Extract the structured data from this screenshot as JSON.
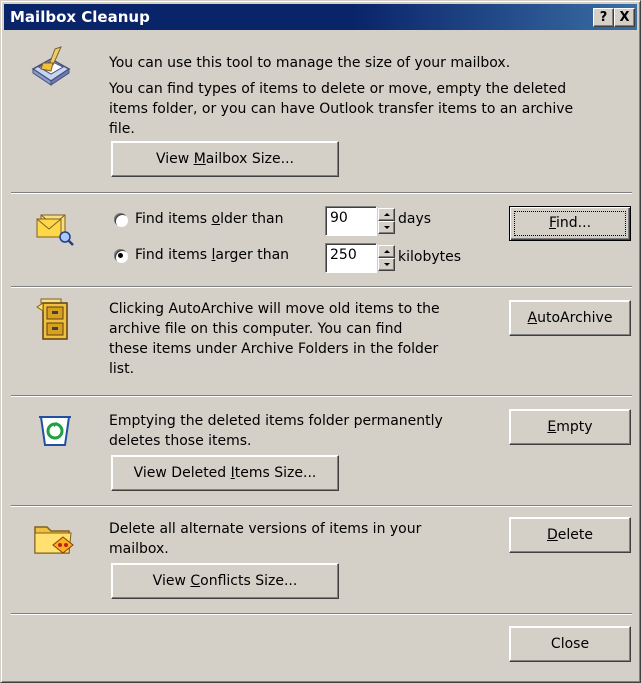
{
  "window": {
    "title": "Mailbox Cleanup",
    "help_button": "?",
    "close_button": "X"
  },
  "intro": {
    "line1": "You can use this tool to manage the size of your mailbox.",
    "line2a": "You can find types of items to delete or move, empty the deleted",
    "line2b": "items folder, or you can have Outlook transfer items to an archive",
    "line2c": "file.",
    "view_size_pre": "View ",
    "view_size_ul": "M",
    "view_size_post": "ailbox Size..."
  },
  "find": {
    "older_pre": "Find items ",
    "older_ul": "o",
    "older_post": "lder than",
    "older_selected": false,
    "older_value": "90",
    "older_unit": "days",
    "larger_pre": "Find items ",
    "larger_ul": "l",
    "larger_post": "arger than",
    "larger_selected": true,
    "larger_value": "250",
    "larger_unit": "kilobytes",
    "find_ul": "F",
    "find_post": "ind..."
  },
  "archive": {
    "line1": "Clicking AutoArchive will move old items to the",
    "line2": "archive file on this computer. You can find",
    "line3": "these items under Archive Folders in the folder",
    "line4": "list.",
    "button_ul": "A",
    "button_post": "utoArchive"
  },
  "deleted": {
    "line1": "Emptying the deleted items folder permanently",
    "line2": "deletes those items.",
    "view_pre": "View Deleted ",
    "view_ul": "I",
    "view_post": "tems Size...",
    "empty_ul": "E",
    "empty_post": "mpty"
  },
  "conflicts": {
    "line1": "Delete all alternate versions of items in your",
    "line2": "mailbox.",
    "view_pre": "View ",
    "view_ul": "C",
    "view_post": "onflicts Size...",
    "delete_ul": "D",
    "delete_post": "elete"
  },
  "footer": {
    "close_label": "Close"
  },
  "colors": {
    "titlebar": "#0a246a",
    "face": "#d4d0c8"
  }
}
